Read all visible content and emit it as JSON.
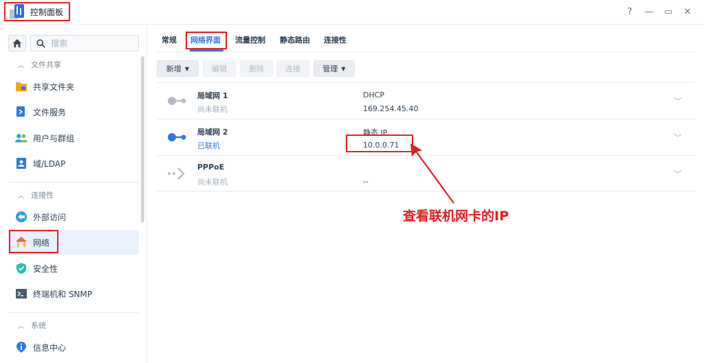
{
  "window": {
    "title": "控制面板",
    "controls": {
      "help": "?",
      "minimize": "—",
      "maximize": "▭",
      "close": "✕"
    }
  },
  "sidebar": {
    "search_placeholder": "搜索",
    "sections": [
      {
        "label": "文件共享",
        "items": [
          "共享文件夹",
          "文件服务",
          "用户与群组",
          "域/LDAP"
        ]
      },
      {
        "label": "连接性",
        "items": [
          "外部访问",
          "网络",
          "安全性",
          "终端机和 SNMP"
        ]
      },
      {
        "label": "系统",
        "items": [
          "信息中心"
        ]
      }
    ],
    "active_item": "网络"
  },
  "tabs": [
    "常规",
    "网络界面",
    "流量控制",
    "静态路由",
    "连接性"
  ],
  "active_tab": "网络界面",
  "toolbar": {
    "add": "新增",
    "edit": "编辑",
    "delete": "删除",
    "connect": "连接",
    "manage": "管理"
  },
  "interfaces": [
    {
      "name": "局域网 1",
      "status": "尚未联机",
      "type": "DHCP",
      "ip": "169.254.45.40",
      "connected": false
    },
    {
      "name": "局域网 2",
      "status": "已联机",
      "type": "静态 IP",
      "ip": "10.0.0.71",
      "connected": true
    },
    {
      "name": "PPPoE",
      "status": "尚未联机",
      "type": "",
      "ip": "--",
      "connected": false
    }
  ],
  "annotation": "查看联机网卡的IP",
  "colors": {
    "accent": "#2b78e4",
    "highlight": "#e02020",
    "active_bg": "#e8f1fc"
  }
}
